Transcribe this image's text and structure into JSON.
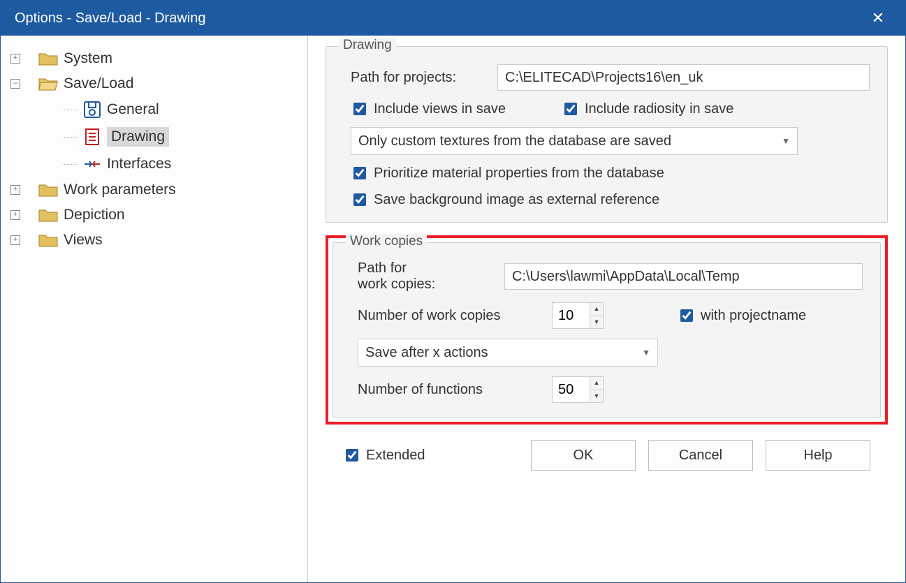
{
  "titlebar": {
    "title": "Options - Save/Load - Drawing"
  },
  "tree": {
    "system": "System",
    "saveload": "Save/Load",
    "general": "General",
    "drawing": "Drawing",
    "interfaces": "Interfaces",
    "workparams": "Work parameters",
    "depiction": "Depiction",
    "views": "Views"
  },
  "drawing_group": {
    "title": "Drawing",
    "path_lbl": "Path for projects:",
    "path_val": "C:\\ELITECAD\\Projects16\\en_uk",
    "include_views": "Include views in save",
    "include_radiosity": "Include radiosity in save",
    "texture_dropdown": "Only custom textures from the database are saved",
    "prioritize": "Prioritize material properties from the database",
    "save_bg": "Save background image as external reference"
  },
  "workcopies_group": {
    "title": "Work copies",
    "path_lbl1": "Path for",
    "path_lbl2": "work copies:",
    "path_val": "C:\\Users\\lawmi\\AppData\\Local\\Temp",
    "num_copies_lbl": "Number of work copies",
    "num_copies_val": "10",
    "with_projectname": "with projectname",
    "save_after_dropdown": "Save after x actions",
    "num_funcs_lbl": "Number of functions",
    "num_funcs_val": "50"
  },
  "footer": {
    "extended": "Extended",
    "ok": "OK",
    "cancel": "Cancel",
    "help": "Help"
  }
}
